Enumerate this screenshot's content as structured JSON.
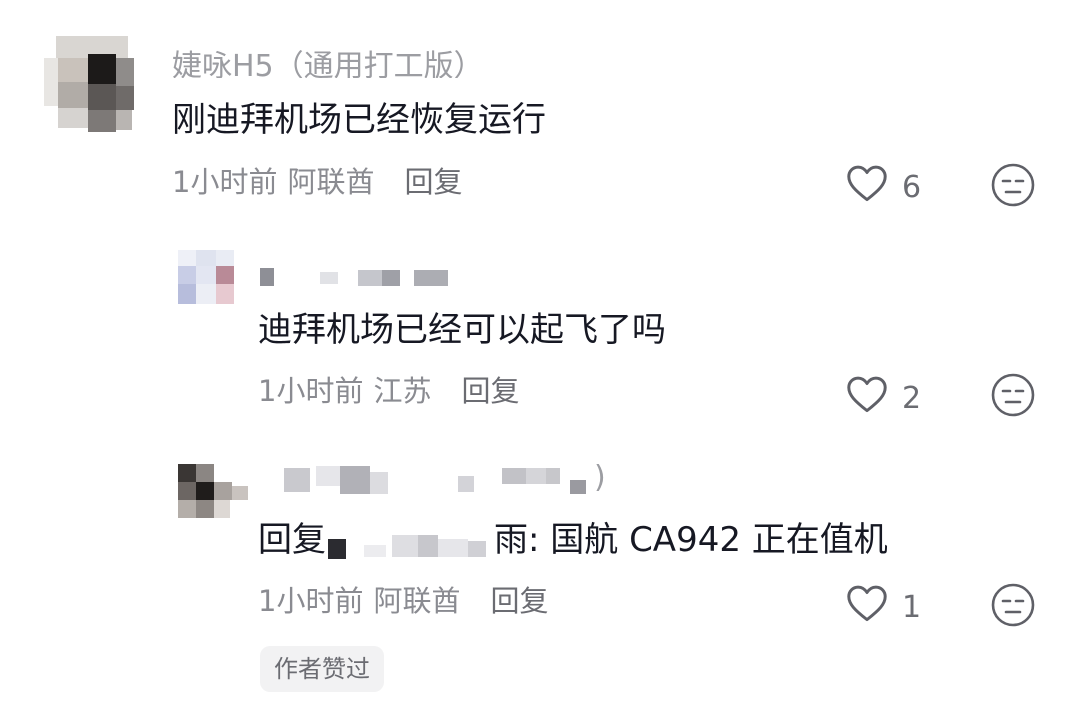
{
  "comments": [
    {
      "username": "婕咏H5（通用打工版）",
      "text": "刚迪拜机场已经恢复运行",
      "time": "1小时前",
      "location": "阿联酋",
      "reply_label": "回复",
      "likes": "6"
    },
    {
      "username": "",
      "text": "迪拜机场已经可以起飞了吗",
      "time": "1小时前",
      "location": "江苏",
      "reply_label": "回复",
      "likes": "2"
    },
    {
      "username": "",
      "text_prefix": "回复",
      "text_suffix": "雨: 国航 CA942 正在值机",
      "time": "1小时前",
      "location": "阿联酋",
      "reply_label": "回复",
      "likes": "1",
      "badge": "作者赞过"
    }
  ],
  "icons": {
    "like": "heart-outline-icon",
    "dislike": "neutral-face-icon"
  },
  "colors": {
    "text": "#161823",
    "meta": "#8a8b91",
    "icon": "#5f6067"
  }
}
